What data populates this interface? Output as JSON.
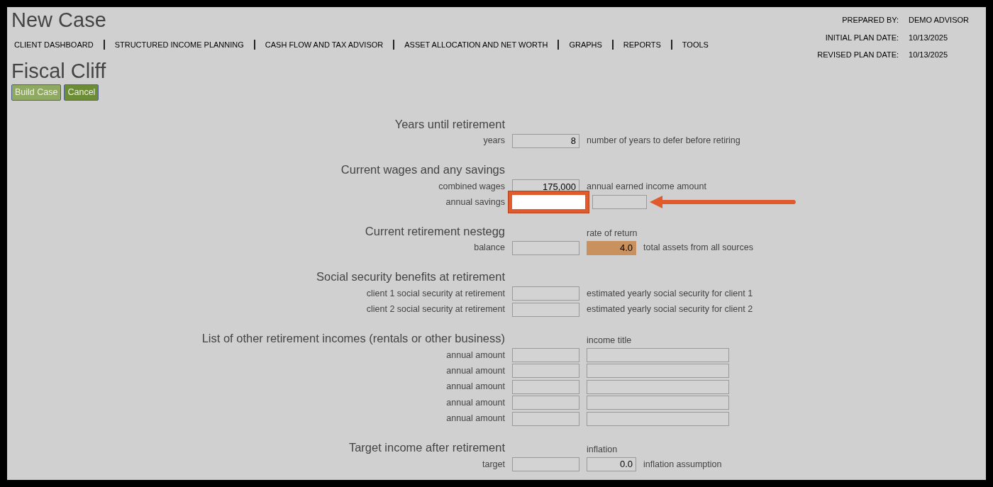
{
  "page_title": "New Case",
  "nav": [
    "CLIENT DASHBOARD",
    "STRUCTURED INCOME PLANNING",
    "CASH FLOW AND TAX ADVISOR",
    "ASSET ALLOCATION AND NET WORTH",
    "GRAPHS",
    "REPORTS",
    "TOOLS"
  ],
  "plan_info": [
    {
      "label": "PREPARED BY:",
      "value": "DEMO ADVISOR"
    },
    {
      "label": "INITIAL PLAN DATE:",
      "value": "10/13/2025"
    },
    {
      "label": "REVISED PLAN DATE:",
      "value": "10/13/2025"
    }
  ],
  "case_title": "Fiscal Cliff",
  "buttons": [
    {
      "label": "Build Case",
      "kind": "primary"
    },
    {
      "label": "Cancel",
      "kind": "secondary"
    }
  ],
  "sections": [
    {
      "heading": "Years until retirement",
      "rows": [
        {
          "label": "years",
          "value": "8",
          "note": "number of years to defer before retiring"
        }
      ]
    },
    {
      "heading": "Current wages and any savings",
      "rows": [
        {
          "label": "combined wages",
          "value": "175,000",
          "note": "annual earned income amount"
        },
        {
          "label": "annual savings",
          "highlighted": true,
          "extra": {
            "kind": "select"
          }
        }
      ]
    },
    {
      "heading": "Current retirement nestegg",
      "side_heading": "rate of return",
      "rows": [
        {
          "label": "balance",
          "extra": {
            "kind": "rate",
            "value": "4.0"
          },
          "note": "total assets from all sources"
        }
      ]
    },
    {
      "heading": "Social security benefits at retirement",
      "rows": [
        {
          "label": "client 1 social security at retirement",
          "note": "estimated yearly social security for client 1"
        },
        {
          "label": "client 2 social security at retirement",
          "note": "estimated yearly social security for client 2"
        }
      ]
    },
    {
      "heading": "List of other retirement incomes (rentals or other business)",
      "side_heading": "income title",
      "rows": [
        {
          "label": "annual amount",
          "extra": {
            "kind": "text"
          }
        },
        {
          "label": "annual amount",
          "extra": {
            "kind": "text"
          }
        },
        {
          "label": "annual amount",
          "extra": {
            "kind": "text"
          }
        },
        {
          "label": "annual amount",
          "extra": {
            "kind": "text"
          }
        },
        {
          "label": "annual amount",
          "extra": {
            "kind": "text"
          }
        }
      ]
    },
    {
      "heading": "Target income after retirement",
      "side_heading": "inflation",
      "rows": [
        {
          "label": "target",
          "extra": {
            "kind": "number",
            "value": "0.0"
          },
          "note": "inflation assumption"
        }
      ]
    }
  ]
}
